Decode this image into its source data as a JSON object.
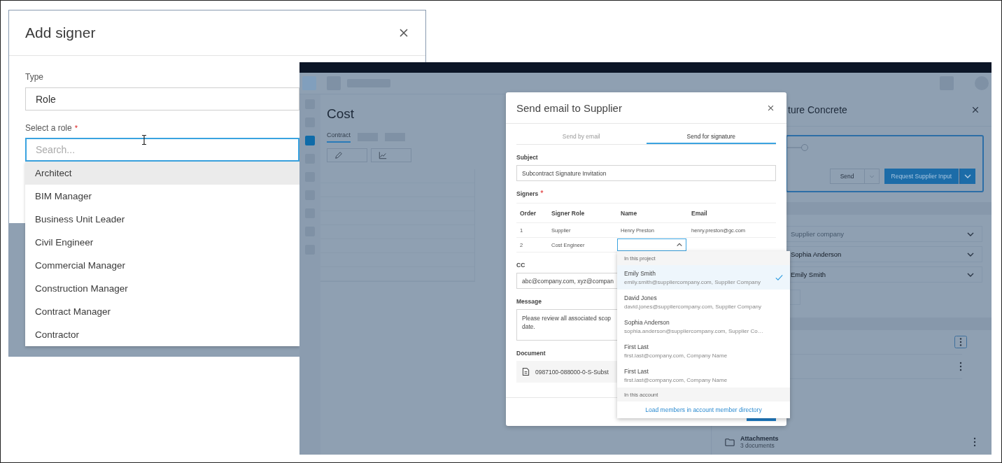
{
  "add_signer_dialog": {
    "title": "Add signer",
    "type_field": {
      "label": "Type",
      "value": "Role"
    },
    "role_field": {
      "label": "Select a role",
      "required_mark": "*",
      "placeholder": "Search..."
    },
    "roles": [
      {
        "label": "Architect",
        "highlighted": true
      },
      {
        "label": "BIM Manager",
        "highlighted": false
      },
      {
        "label": "Business Unit Leader",
        "highlighted": false
      },
      {
        "label": "Civil Engineer",
        "highlighted": false
      },
      {
        "label": "Commercial Manager",
        "highlighted": false
      },
      {
        "label": "Construction Manager",
        "highlighted": false
      },
      {
        "label": "Contract Manager",
        "highlighted": false
      },
      {
        "label": "Contractor",
        "highlighted": false
      }
    ]
  },
  "app_backdrop": {
    "sidebar": [
      {
        "selected": false
      },
      {
        "selected": false
      },
      {
        "selected": true
      },
      {
        "selected": false
      },
      {
        "selected": false
      },
      {
        "selected": false
      },
      {
        "selected": false
      },
      {
        "selected": false
      },
      {
        "selected": false
      }
    ],
    "page_title": "Cost",
    "tabs": [
      {
        "label": "Contract",
        "selected": true
      }
    ],
    "side_panel": {
      "title": "ture Concrete",
      "send_button": "Send",
      "request_button": "Request Supplier Input",
      "fields": [
        {
          "placeholder": "Supplier company"
        },
        {
          "value": "Sophia Anderson"
        },
        {
          "value": "Emily Smith"
        }
      ],
      "attachments": {
        "title": "Attachments",
        "count": "3 documents"
      }
    }
  },
  "send_email_dialog": {
    "title": "Send email to Supplier",
    "tabs": [
      {
        "label": "Send by email",
        "selected": false
      },
      {
        "label": "Send for signature",
        "selected": true
      }
    ],
    "subject": {
      "label": "Subject",
      "value": "Subcontract Signature Invitation"
    },
    "signers": {
      "label": "Signers",
      "required_mark": "*",
      "columns": [
        "Order",
        "Signer Role",
        "Name",
        "Email"
      ],
      "rows": [
        {
          "order": "1",
          "role": "Supplier",
          "name": "Henry Preston",
          "email": "henry.preston@gc.com",
          "name_open": false
        },
        {
          "order": "2",
          "role": "Cost Engineer",
          "name": "",
          "email": "",
          "name_open": true
        }
      ]
    },
    "cc": {
      "label": "CC",
      "value": "abc@company.com, xyz@compan"
    },
    "message": {
      "label": "Message",
      "lines": [
        "Please review all associated scop",
        "date."
      ]
    },
    "document": {
      "label": "Document",
      "file": "0987100-088000-0-S-Subst"
    }
  },
  "name_dropdown": {
    "groups": [
      {
        "label": "In this project",
        "options": [
          {
            "name": "Emily Smith",
            "detail": "emily.smith@suppliercompany.com, Supplier Company",
            "selected": true
          },
          {
            "name": "David Jones",
            "detail": "david.jones@suppliercompany.com, Supplier Company",
            "selected": false
          },
          {
            "name": "Sophia Anderson",
            "detail": "sophia.anderson@suppliercompany.com, Supplier Co…",
            "selected": false
          },
          {
            "name": "First Last",
            "detail": "first.last@company.com, Company Name",
            "selected": false
          },
          {
            "name": "First Last",
            "detail": "first.last@company.com, Company Name",
            "selected": false
          }
        ]
      },
      {
        "label": "In this account",
        "link": "Load members in account member directory"
      }
    ]
  }
}
